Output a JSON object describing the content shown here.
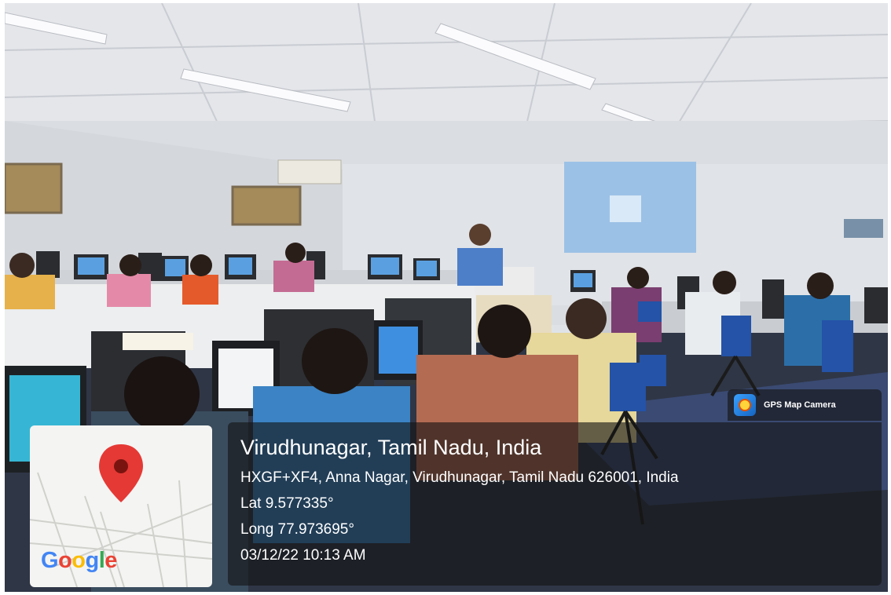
{
  "overlay": {
    "city": "Virudhunagar, Tamil Nadu, India",
    "address": "HXGF+XF4, Anna Nagar, Virudhunagar, Tamil Nadu 626001, India",
    "latitude": "Lat 9.577335°",
    "longitude": "Long 77.973695°",
    "datetime": "03/12/22 10:13 AM"
  },
  "badge": {
    "label": "GPS Map Camera",
    "icon": "camera-pin-icon"
  },
  "map": {
    "logo_letters": [
      "G",
      "o",
      "o",
      "g",
      "l",
      "e"
    ],
    "logo_colors": [
      "#4285F4",
      "#EA4335",
      "#FBBC05",
      "#4285F4",
      "#34A853",
      "#EA4335"
    ],
    "pin_color": "#E53935",
    "icon": "map-pin-icon"
  },
  "colors": {
    "overlay_bg": "#141414",
    "text": "#ffffff"
  }
}
